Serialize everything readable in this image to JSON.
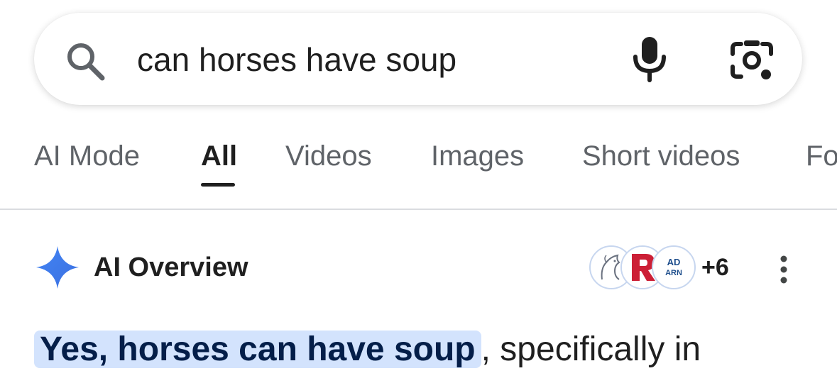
{
  "search": {
    "query": "can horses have soup",
    "icons": {
      "search": "search-icon",
      "mic": "microphone-icon",
      "lens": "google-lens-icon"
    }
  },
  "tabs": [
    {
      "label": "AI Mode",
      "active": false
    },
    {
      "label": "All",
      "active": true
    },
    {
      "label": "Videos",
      "active": false
    },
    {
      "label": "Images",
      "active": false
    },
    {
      "label": "Short videos",
      "active": false
    },
    {
      "label": "Fo",
      "active": false
    }
  ],
  "ai_overview": {
    "title": "AI Overview",
    "sources_more": "+6",
    "source_icons": [
      "horse-logo-icon",
      "r-logo-icon",
      "ad-barn-logo-icon"
    ],
    "answer_highlight": "Yes, horses can have soup",
    "answer_rest": ", specifically in"
  },
  "colors": {
    "accent_blue": "#4285f4",
    "highlight_bg": "#d3e3fd",
    "text_primary": "#1f1f1f",
    "text_secondary": "#5f6368"
  }
}
